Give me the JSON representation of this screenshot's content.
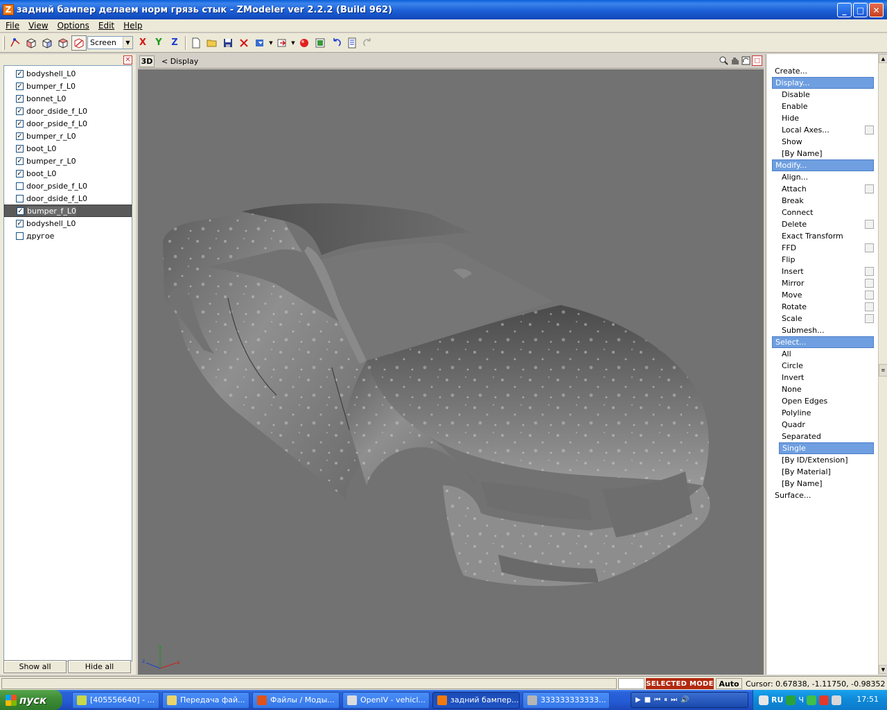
{
  "window": {
    "title": "задний бампер делаем норм грязь стык - ZModeler ver 2.2.2 (Build 962)",
    "app_icon_letter": "Z",
    "controls": {
      "minimize": "_",
      "maximize": "□",
      "close": "✕"
    }
  },
  "menu": [
    "File",
    "View",
    "Options",
    "Edit",
    "Help"
  ],
  "toolbar": {
    "space_select": "Screen",
    "axis_x": "X",
    "axis_y": "Y",
    "axis_z": "Z",
    "icons": [
      "select-vertex-icon",
      "select-cube-icon",
      "select-box-icon",
      "select-cube-x-icon",
      "select-cube-active-icon",
      "new-icon",
      "open-icon",
      "save-icon",
      "delete-icon",
      "import-icon",
      "export-icon",
      "render-icon",
      "screenshot-icon",
      "undo-icon",
      "options-icon",
      "redo-icon"
    ]
  },
  "objects": {
    "close_glyph": "✕",
    "items": [
      {
        "label": "bodyshell_L0",
        "checked": true
      },
      {
        "label": "bumper_f_L0",
        "checked": true
      },
      {
        "label": "bonnet_L0",
        "checked": true
      },
      {
        "label": "door_dside_f_L0",
        "checked": true
      },
      {
        "label": "door_pside_f_L0",
        "checked": true
      },
      {
        "label": "bumper_r_L0",
        "checked": true
      },
      {
        "label": "boot_L0",
        "checked": true
      },
      {
        "label": "bumper_r_L0",
        "checked": true
      },
      {
        "label": "boot_L0",
        "checked": true
      },
      {
        "label": "door_pside_f_L0",
        "checked": false
      },
      {
        "label": "door_dside_f_L0",
        "checked": false
      },
      {
        "label": "bumper_f_L0",
        "checked": true,
        "selected": true
      },
      {
        "label": "bodyshell_L0",
        "checked": true
      },
      {
        "label": "другое",
        "checked": false
      }
    ],
    "show_all": "Show all",
    "hide_all": "Hide all"
  },
  "viewport": {
    "mode": "3D",
    "breadcrumb": "<  Display",
    "background": "#727272",
    "gizmo": {
      "x": "x",
      "y": "y",
      "z": "z"
    }
  },
  "commands": {
    "items": [
      {
        "label": "Create...",
        "kind": "head"
      },
      {
        "label": "Display...",
        "kind": "headsel"
      },
      {
        "label": "Disable",
        "kind": "sub"
      },
      {
        "label": "Enable",
        "kind": "sub"
      },
      {
        "label": "Hide",
        "kind": "sub"
      },
      {
        "label": "Local Axes...",
        "kind": "sub",
        "box": true
      },
      {
        "label": "Show",
        "kind": "sub"
      },
      {
        "label": "[By Name]",
        "kind": "sub"
      },
      {
        "label": "Modify...",
        "kind": "headsel"
      },
      {
        "label": "Align...",
        "kind": "sub"
      },
      {
        "label": "Attach",
        "kind": "sub",
        "box": true
      },
      {
        "label": "Break",
        "kind": "sub"
      },
      {
        "label": "Connect",
        "kind": "sub"
      },
      {
        "label": "Delete",
        "kind": "sub",
        "box": true
      },
      {
        "label": "Exact Transform",
        "kind": "sub"
      },
      {
        "label": "FFD",
        "kind": "sub",
        "box": true
      },
      {
        "label": "Flip",
        "kind": "sub"
      },
      {
        "label": "Insert",
        "kind": "sub",
        "box": true
      },
      {
        "label": "Mirror",
        "kind": "sub",
        "box": true
      },
      {
        "label": "Move",
        "kind": "sub",
        "box": true
      },
      {
        "label": "Rotate",
        "kind": "sub",
        "box": true
      },
      {
        "label": "Scale",
        "kind": "sub",
        "box": true
      },
      {
        "label": "Submesh...",
        "kind": "sub"
      },
      {
        "label": "Select...",
        "kind": "headsel"
      },
      {
        "label": "All",
        "kind": "sub"
      },
      {
        "label": "Circle",
        "kind": "sub"
      },
      {
        "label": "Invert",
        "kind": "sub"
      },
      {
        "label": "None",
        "kind": "sub"
      },
      {
        "label": "Open Edges",
        "kind": "sub"
      },
      {
        "label": "Polyline",
        "kind": "sub"
      },
      {
        "label": "Quadr",
        "kind": "sub"
      },
      {
        "label": "Separated",
        "kind": "sub"
      },
      {
        "label": "Single",
        "kind": "subsel"
      },
      {
        "label": "[By ID/Extension]",
        "kind": "sub"
      },
      {
        "label": "[By Material]",
        "kind": "sub"
      },
      {
        "label": "[By Name]",
        "kind": "sub"
      },
      {
        "label": "Surface...",
        "kind": "head"
      }
    ]
  },
  "status": {
    "mode": "SELECTED MODE",
    "auto": "Auto",
    "cursor": "Cursor: 0.67838, -1.11750, -0.98352"
  },
  "taskbar": {
    "start": "пуск",
    "tasks": [
      {
        "label": "[405556640] - ...",
        "color": "#c8d84a"
      },
      {
        "label": "Передача фай...",
        "color": "#e9d46b"
      },
      {
        "label": "Файлы / Моды...",
        "color": "#e0531b"
      },
      {
        "label": "OpenIV - vehicl...",
        "color": "#dcdcdc"
      },
      {
        "label": "задний бампер...",
        "color": "#f07a10",
        "active": true
      },
      {
        "label": "333333333333...",
        "color": "#b5b5b5"
      }
    ],
    "tray_lang": "RU",
    "tray_ch": "Ч",
    "clock": "17:51"
  }
}
